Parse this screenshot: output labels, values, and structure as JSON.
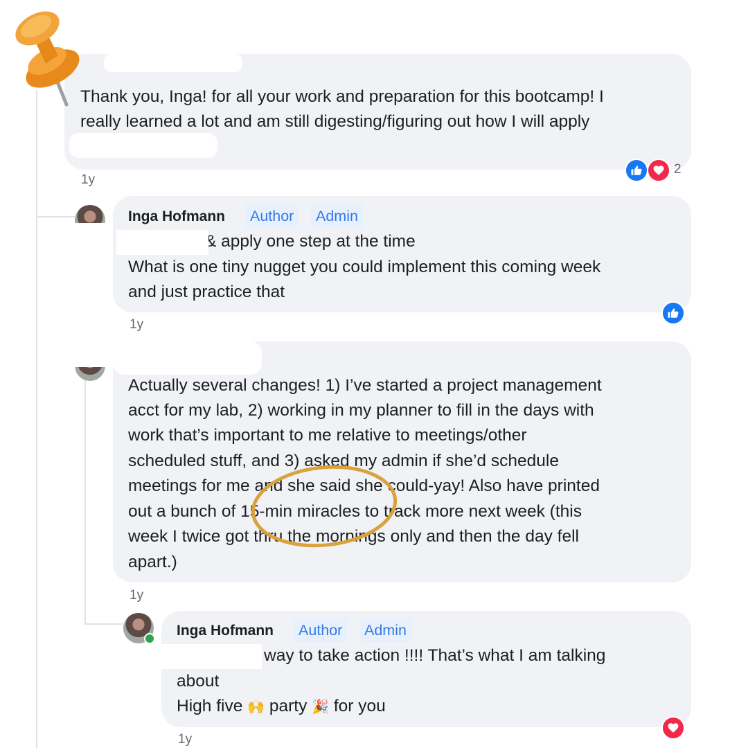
{
  "comments": [
    {
      "text_lines": [
        "Thank you, Inga! for all your work and preparation for this bootcamp! I",
        "really learned a lot and am still digesting/figuring out how I will apply"
      ],
      "timestamp": "1y",
      "reactions": {
        "icons": [
          "like-icon",
          "love-icon"
        ],
        "count": "2"
      }
    },
    {
      "author": "Inga Hofmann",
      "badges": [
        "Author",
        "Admin"
      ],
      "text_lines": [
        "& apply one step at the time",
        "What is one tiny nugget you could implement this coming week",
        "and just practice that"
      ],
      "timestamp": "1y",
      "reactions": {
        "icons": [
          "like-icon"
        ]
      }
    },
    {
      "text_lines": [
        "Actually several changes! 1) I’ve started a project management",
        "acct for my lab, 2) working in my planner to fill in the days with",
        "work that’s important to me relative to meetings/other",
        "scheduled stuff, and 3) asked my admin if she’d schedule",
        "meetings for me and she said she could-yay! Also have printed",
        "out a bunch of 15-min miracles to track more next week (this",
        "week I twice got thru the mornings only and then the day fell",
        "apart.)"
      ],
      "timestamp": "1y"
    },
    {
      "author": "Inga Hofmann",
      "badges": [
        "Author",
        "Admin"
      ],
      "text_lines": [
        "way to take action !!!! That’s what I am talking",
        "about"
      ],
      "line3": {
        "a": "High five",
        "emoji1": "🙌",
        "b": "party",
        "emoji2": "🎉",
        "c": "for you"
      },
      "timestamp": "1y",
      "reactions": {
        "icons": [
          "love-icon"
        ]
      }
    }
  ],
  "decoration": {
    "pushpin": "pushpin-icon",
    "highlight_circle_color": "#d9a23c"
  },
  "colors": {
    "bubble": "#f0f2f5",
    "badge_bg": "#e7f0fd",
    "badge_text": "#3578e5",
    "like": "#1877f2",
    "love": "#f0284a"
  }
}
